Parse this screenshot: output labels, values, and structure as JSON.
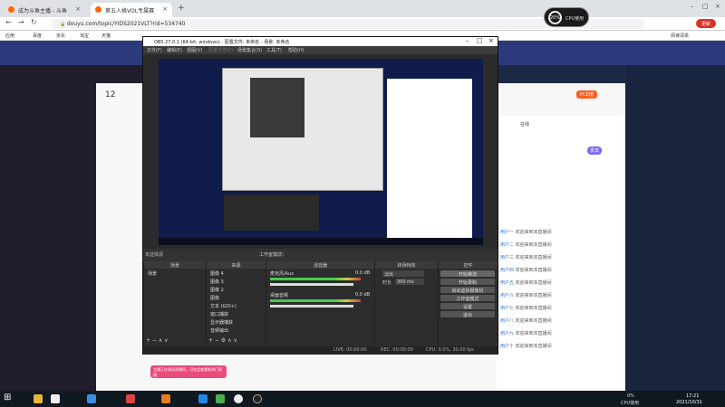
{
  "browser": {
    "tabs": [
      {
        "label": "成为斗鱼主播 - 斗鱼"
      },
      {
        "label": "第五人格VOL专属赛"
      }
    ],
    "url": "douyu.com/topic/YIDS2021VLT?rid=534740",
    "update_label": "更新",
    "bookmarks": [
      "应用",
      "百度",
      "京东",
      "淘宝",
      "天猫",
      "腾讯视频",
      "爱奇艺",
      "优酷",
      "微博",
      "搜狐",
      "新浪",
      "网易"
    ],
    "reading_list": "阅读清单"
  },
  "cpu_widget": {
    "percent": "20%",
    "label": "CPU使用"
  },
  "page": {
    "count": "12",
    "rank_label": "PCK榜",
    "sidebar_title": "在线",
    "sidebar_tab": "贵宾",
    "chat": [
      {
        "user": "用户一",
        "text": "欢迎来到本直播间"
      },
      {
        "user": "用户二",
        "text": "欢迎来到本直播间"
      },
      {
        "user": "用户三",
        "text": "欢迎来到本直播间"
      },
      {
        "user": "用户四",
        "text": "欢迎来到本直播间"
      },
      {
        "user": "用户五",
        "text": "欢迎来到本直播间"
      },
      {
        "user": "用户六",
        "text": "欢迎来到本直播间"
      },
      {
        "user": "用户七",
        "text": "欢迎来到本直播间"
      },
      {
        "user": "用户八",
        "text": "欢迎来到本直播间"
      },
      {
        "user": "用户九",
        "text": "欢迎来到本直播间"
      },
      {
        "user": "用户十",
        "text": "欢迎来到本直播间"
      }
    ],
    "toast": "主播正在调试直播间，可在此查看新热门直播"
  },
  "obs": {
    "title": "OBS 27.0.1 (64-bit, windows) - 配置文件: 未命名 - 场景: 未命名",
    "menu": [
      "文件(F)",
      "编辑(E)",
      "视图(V)",
      "配置文件(P)",
      "场景集合(S)",
      "工具(T)",
      "帮助(H)"
    ],
    "scene_bar": {
      "studio": "工作室模式",
      "exit": "退出"
    },
    "docks": {
      "scenes": "场景",
      "sources": "来源",
      "mixer": "混音器",
      "transitions": "转场特效",
      "controls": "控件"
    },
    "untitled_label": "未选择源",
    "scenes": [
      "场景"
    ],
    "sources": [
      "图像 4",
      "图像 3",
      "图像 2",
      "图像",
      "文本 (GDI+)",
      "窗口捕获",
      "显示器捕获",
      "音频输出"
    ],
    "mixer": [
      {
        "name": "麦克风/Aux",
        "db": "0.0 dB"
      },
      {
        "name": "桌面音频",
        "db": "0.0 dB"
      }
    ],
    "transition": {
      "type": "淡出",
      "duration_label": "时长",
      "duration": "300 ms"
    },
    "controls": [
      "开始推流",
      "开始录制",
      "启动虚拟摄像机",
      "工作室模式",
      "设置",
      "退出"
    ],
    "status": {
      "live": "LIVE: 00:00:00",
      "rec": "REC: 00:00:00",
      "cpu": "CPU: 0.0%, 30.00 fps"
    }
  },
  "taskbar": {
    "cpu": "0%",
    "cpu_label": "CPU使用",
    "time": "17:21",
    "date": "2021/10/31"
  }
}
